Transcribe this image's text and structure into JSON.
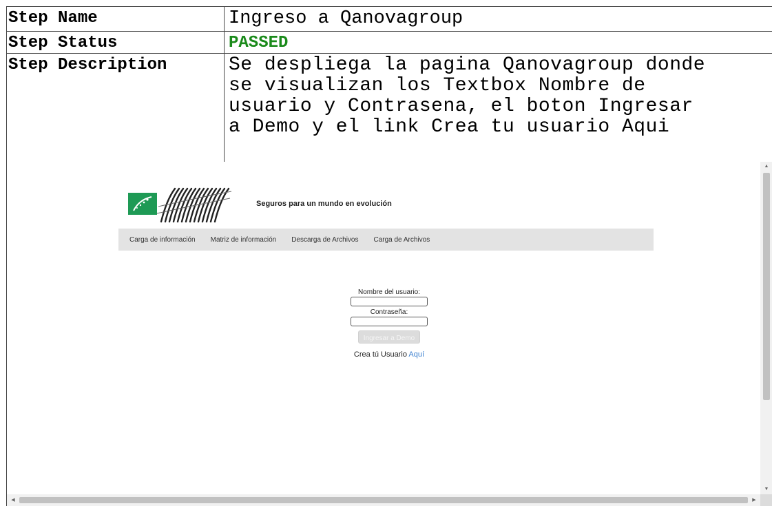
{
  "report": {
    "step_name_label": "Step Name",
    "step_name_value": "Ingreso a Qanovagroup",
    "step_status_label": "Step Status",
    "step_status_value": "PASSED",
    "step_description_label": "Step Description",
    "step_description_value": "Se despliega la pagina Qanovagroup donde\nse visualizan los Textbox Nombre de\nusuario y Contrasena, el boton Ingresar\na Demo y el link Crea tu usuario Aqui"
  },
  "screenshot": {
    "tagline": "Seguros para un mundo en evolución",
    "nav": [
      "Carga de información",
      "Matriz de información",
      "Descarga de Archivos",
      "Carga de Archivos"
    ],
    "login": {
      "username_label": "Nombre del usuario:",
      "username_value": "",
      "password_label": "Contraseña:",
      "password_value": "",
      "submit_label": "Ingresar a Demo",
      "create_text": "Crea tú Usuario",
      "create_link": "Aquí"
    }
  },
  "colors": {
    "passed": "#1a8a1a",
    "logo_green": "#1e9a55",
    "nav_bg": "#e3e3e3",
    "link": "#3a7fcf"
  },
  "icons": {
    "logo": "bnp-star-logo",
    "brand_mark": "striped-wordmark",
    "scroll_up": "arrow-up-icon",
    "scroll_down": "arrow-down-icon",
    "scroll_left": "arrow-left-icon",
    "scroll_right": "arrow-right-icon"
  }
}
